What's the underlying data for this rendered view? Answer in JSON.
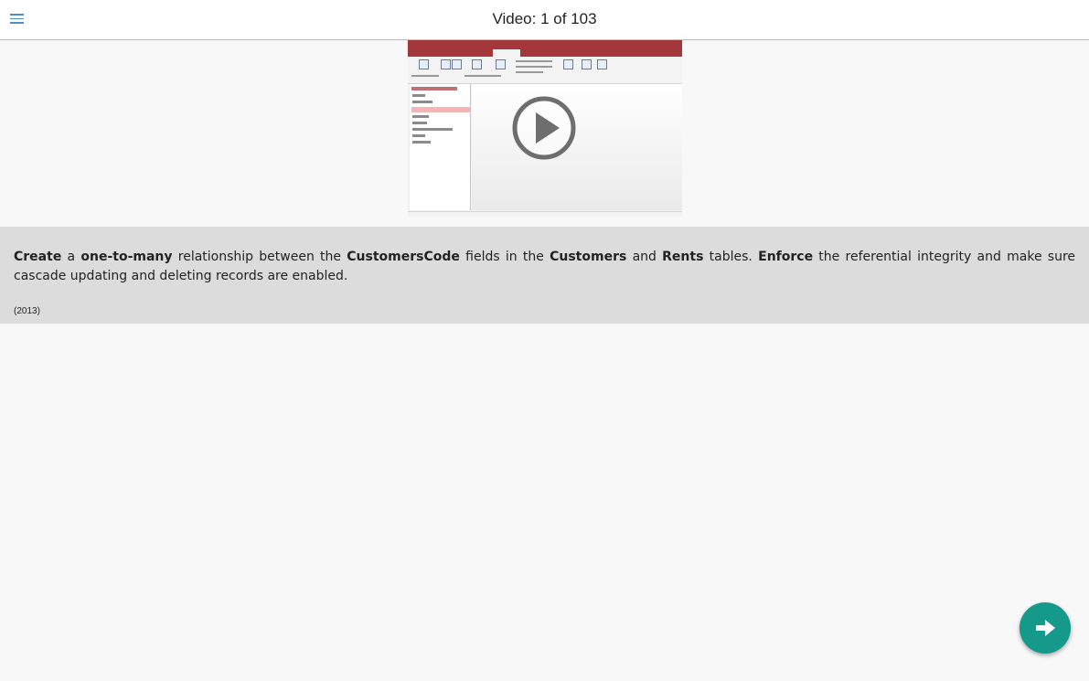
{
  "header": {
    "title": "Video: 1 of 103",
    "menu_icon": "hamburger-menu-icon"
  },
  "video": {
    "play_icon": "play-icon"
  },
  "question": {
    "parts": [
      {
        "text": "Create",
        "bold": true
      },
      {
        "text": " a ",
        "bold": false
      },
      {
        "text": "one-to-many",
        "bold": true
      },
      {
        "text": " relationship between the ",
        "bold": false
      },
      {
        "text": "CustomersCode",
        "bold": true
      },
      {
        "text": " fields in the ",
        "bold": false
      },
      {
        "text": "Customers",
        "bold": true
      },
      {
        "text": " and ",
        "bold": false
      },
      {
        "text": "Rents",
        "bold": true
      },
      {
        "text": " tables. ",
        "bold": false
      },
      {
        "text": "Enforce",
        "bold": true
      },
      {
        "text": " the referential integrity and make sure cascade updating and deleting records are enabled.",
        "bold": false
      }
    ],
    "year": "(2013)"
  },
  "footer": {
    "next_icon": "arrow-right-icon",
    "accent_color": "#14998a"
  }
}
